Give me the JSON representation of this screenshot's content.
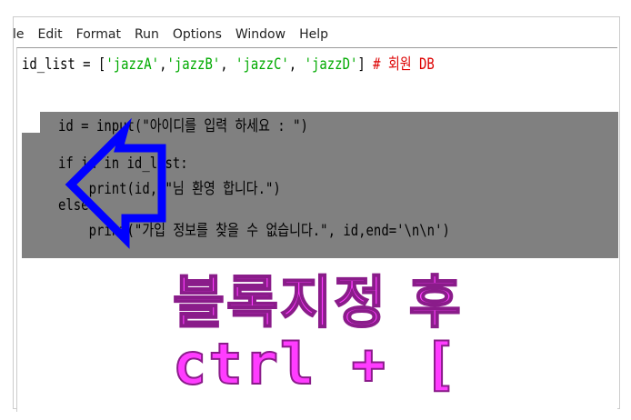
{
  "menu": [
    "le",
    "Edit",
    "Format",
    "Run",
    "Options",
    "Window",
    "Help"
  ],
  "code": {
    "line1": {
      "a": "id_list = [",
      "s1": "'jazzA'",
      "c1": ",",
      "s2": "'jazzB'",
      "c2": ", ",
      "s3": "'jazzC'",
      "c3": ", ",
      "s4": "'jazzD'",
      "b": "] ",
      "comment": "# 회원 DB"
    },
    "line2": "id = input(\"아이디를 입력 하세요 : \")",
    "line3": "if id in id_list:",
    "line4": "    print(id, \"님 환영 합니다.\")",
    "line5": "else:",
    "line6": "    print(\"가입 정보를 찾을 수 없습니다.\", id,end='\\n\\n')"
  },
  "annotation": {
    "line1": "블록지정 후",
    "line2": "ctrl + ["
  },
  "colors": {
    "selection": "#808080",
    "arrow": "#0000ff",
    "annotation": "#ff3cff"
  }
}
